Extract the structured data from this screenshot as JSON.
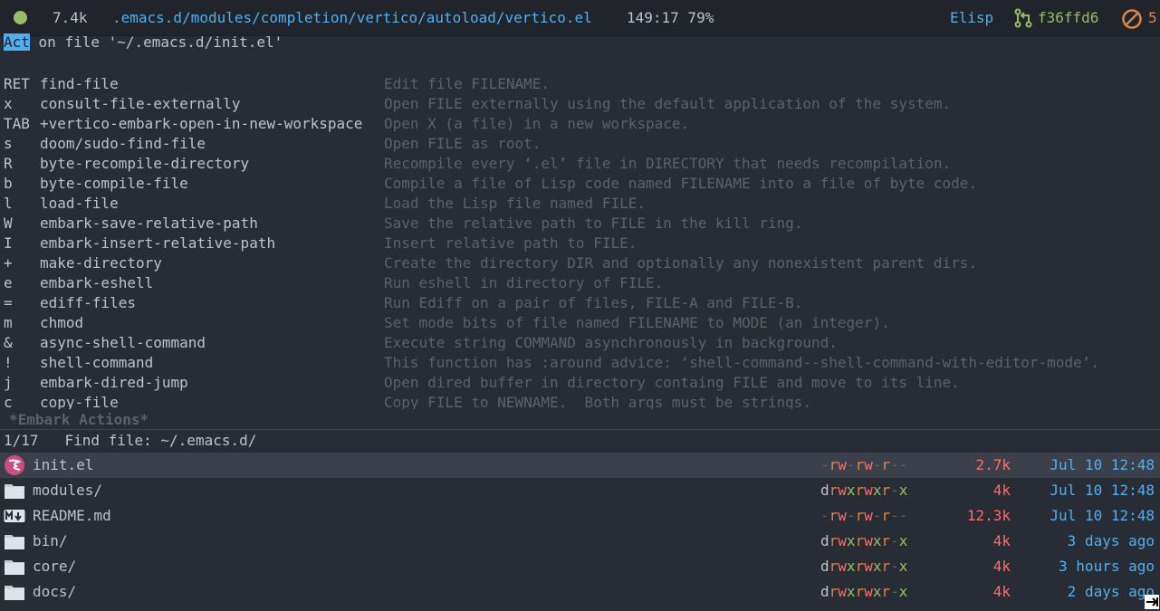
{
  "modeline": {
    "size": "7.4k",
    "path": ".emacs.d/modules/completion/vertico/autoload/vertico.el",
    "position": "149:17 79%",
    "mode": "Elisp",
    "git_hash": "f36ffd6",
    "count": "5",
    "status_color": "#98be65"
  },
  "prompt": {
    "keyword": "Act",
    "text": " on file '~/.emacs.d/init.el'"
  },
  "actions": [
    {
      "key": "RET",
      "command": "find-file",
      "doc": "Edit file FILENAME."
    },
    {
      "key": "x",
      "command": "consult-file-externally",
      "doc": "Open FILE externally using the default application of the system."
    },
    {
      "key": "TAB",
      "command": "+vertico-embark-open-in-new-workspace",
      "doc": "Open X (a file) in a new workspace."
    },
    {
      "key": "s",
      "command": "doom/sudo-find-file",
      "doc": "Open FILE as root."
    },
    {
      "key": "R",
      "command": "byte-recompile-directory",
      "doc": "Recompile every ‘.el’ file in DIRECTORY that needs recompilation."
    },
    {
      "key": "b",
      "command": "byte-compile-file",
      "doc": "Compile a file of Lisp code named FILENAME into a file of byte code."
    },
    {
      "key": "l",
      "command": "load-file",
      "doc": "Load the Lisp file named FILE."
    },
    {
      "key": "W",
      "command": "embark-save-relative-path",
      "doc": "Save the relative path to FILE in the kill ring."
    },
    {
      "key": "I",
      "command": "embark-insert-relative-path",
      "doc": "Insert relative path to FILE."
    },
    {
      "key": "+",
      "command": "make-directory",
      "doc": "Create the directory DIR and optionally any nonexistent parent dirs."
    },
    {
      "key": "e",
      "command": "embark-eshell",
      "doc": "Run eshell in directory of FILE."
    },
    {
      "key": "=",
      "command": "ediff-files",
      "doc": "Run Ediff on a pair of files, FILE-A and FILE-B."
    },
    {
      "key": "m",
      "command": "chmod",
      "doc": "Set mode bits of file named FILENAME to MODE (an integer)."
    },
    {
      "key": "&",
      "command": "async-shell-command",
      "doc": "Execute string COMMAND asynchronously in background."
    },
    {
      "key": "!",
      "command": "shell-command",
      "doc": "This function has :around advice: ‘shell-command--shell-command-with-editor-mode’."
    },
    {
      "key": "j",
      "command": "embark-dired-jump",
      "doc": "Open dired buffer in directory containg FILE and move to its line."
    },
    {
      "key": "c",
      "command": "copy-file",
      "doc": "Copy FILE to NEWNAME.  Both args must be strings."
    }
  ],
  "buffer_name": "*Embark Actions*",
  "minibuffer": {
    "count": "1/17",
    "prompt": "Find file: ",
    "value": "~/.emacs.d/"
  },
  "candidates": [
    {
      "icon": "emacs-lisp-icon",
      "name": "init.el",
      "perm": "-rw-rw-r--",
      "size": "2.7k",
      "date": "Jul 10 12:48",
      "selected": true
    },
    {
      "icon": "folder-icon",
      "name": "modules/",
      "perm": "drwxrwxr-x",
      "size": "4k",
      "date": "Jul 10 12:48",
      "selected": false
    },
    {
      "icon": "markdown-icon",
      "name": "README.md",
      "perm": "-rw-rw-r--",
      "size": "12.3k",
      "date": "Jul 10 12:48",
      "selected": false
    },
    {
      "icon": "folder-icon",
      "name": "bin/",
      "perm": "drwxrwxr-x",
      "size": "4k",
      "date": "3 days ago",
      "selected": false
    },
    {
      "icon": "folder-icon",
      "name": "core/",
      "perm": "drwxrwxr-x",
      "size": "4k",
      "date": "3 hours ago",
      "selected": false
    },
    {
      "icon": "folder-icon",
      "name": "docs/",
      "perm": "drwxrwxr-x",
      "size": "4k",
      "date": "2 days ago",
      "selected": false
    }
  ],
  "colors": {
    "background": "#282c34",
    "modeline": "#21242b",
    "accent": "#51afef",
    "green": "#98be65",
    "orange": "#da8548",
    "red": "#ff6c6b",
    "comment": "#5b6268",
    "selection": "#3b404a"
  }
}
